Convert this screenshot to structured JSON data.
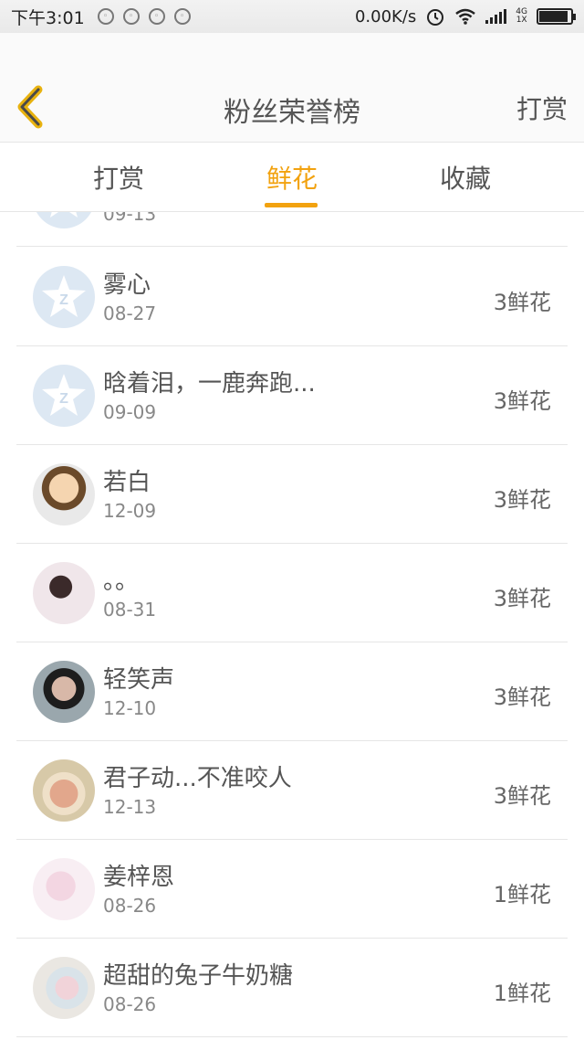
{
  "status_bar": {
    "time": "下午3:01",
    "speed": "0.00K/s",
    "network_tag_top": "4G",
    "network_tag_bottom": "1X",
    "battery_level": 0.85,
    "icons": [
      "notification-icon",
      "notification-icon",
      "notification-icon",
      "notification-icon",
      "alarm-icon",
      "wifi-icon",
      "signal-icon",
      "battery-icon"
    ]
  },
  "header": {
    "title": "粉丝荣誉榜",
    "action_label": "打赏",
    "back_icon": "chevron-left-icon",
    "accent_color": "#f2a20f"
  },
  "tabs": [
    {
      "label": "打赏",
      "active": false
    },
    {
      "label": "鲜花",
      "active": true
    },
    {
      "label": "收藏",
      "active": false
    }
  ],
  "list": {
    "partial_row_date": "09-13",
    "rows": [
      {
        "name": "雾心",
        "date": "08-27",
        "amount": "3鲜花",
        "avatar": "default-avatar-icon"
      },
      {
        "name": "晗着泪，一鹿奔跑...",
        "date": "09-09",
        "amount": "3鲜花",
        "avatar": "default-avatar-icon"
      },
      {
        "name": "若白",
        "date": "12-09",
        "amount": "3鲜花",
        "avatar": "cartoon-avatar"
      },
      {
        "name": "。。",
        "date": "08-31",
        "amount": "3鲜花",
        "avatar": "photo-avatar"
      },
      {
        "name": "轻笑声",
        "date": "12-10",
        "amount": "3鲜花",
        "avatar": "photo-avatar"
      },
      {
        "name": "君子动...不准咬人",
        "date": "12-13",
        "amount": "3鲜花",
        "avatar": "doll-avatar"
      },
      {
        "name": "姜梓恩",
        "date": "08-26",
        "amount": "1鲜花",
        "avatar": "photo-avatar"
      },
      {
        "name": "超甜的兔子牛奶糖",
        "date": "08-26",
        "amount": "1鲜花",
        "avatar": "photo-avatar"
      }
    ]
  }
}
